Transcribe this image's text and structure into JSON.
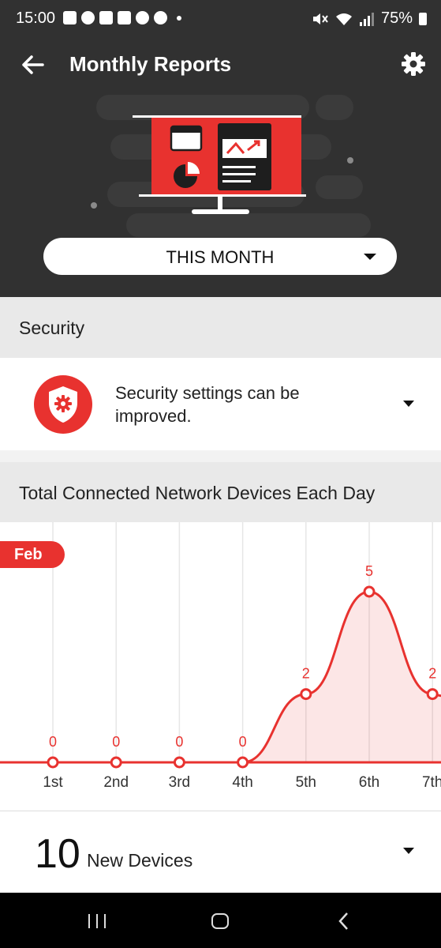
{
  "status_bar": {
    "time": "15:00",
    "battery": "75%"
  },
  "header": {
    "title": "Monthly Reports"
  },
  "period_selector": {
    "value": "THIS MONTH"
  },
  "security": {
    "section_title": "Security",
    "message": "Security settings can be improved."
  },
  "devices": {
    "section_title": "Total Connected Network Devices Each Day"
  },
  "chart_data": {
    "type": "area",
    "month_label": "Feb",
    "categories": [
      "1st",
      "2nd",
      "3rd",
      "4th",
      "5th",
      "6th",
      "7th"
    ],
    "values": [
      0,
      0,
      0,
      0,
      2,
      5,
      2
    ],
    "grid": true,
    "color": "#e8322f"
  },
  "new_devices": {
    "count": "10",
    "label": "New Devices"
  },
  "colors": {
    "accent": "#e8322f",
    "header_bg": "#313131",
    "section_bg": "#e9e9e9"
  }
}
